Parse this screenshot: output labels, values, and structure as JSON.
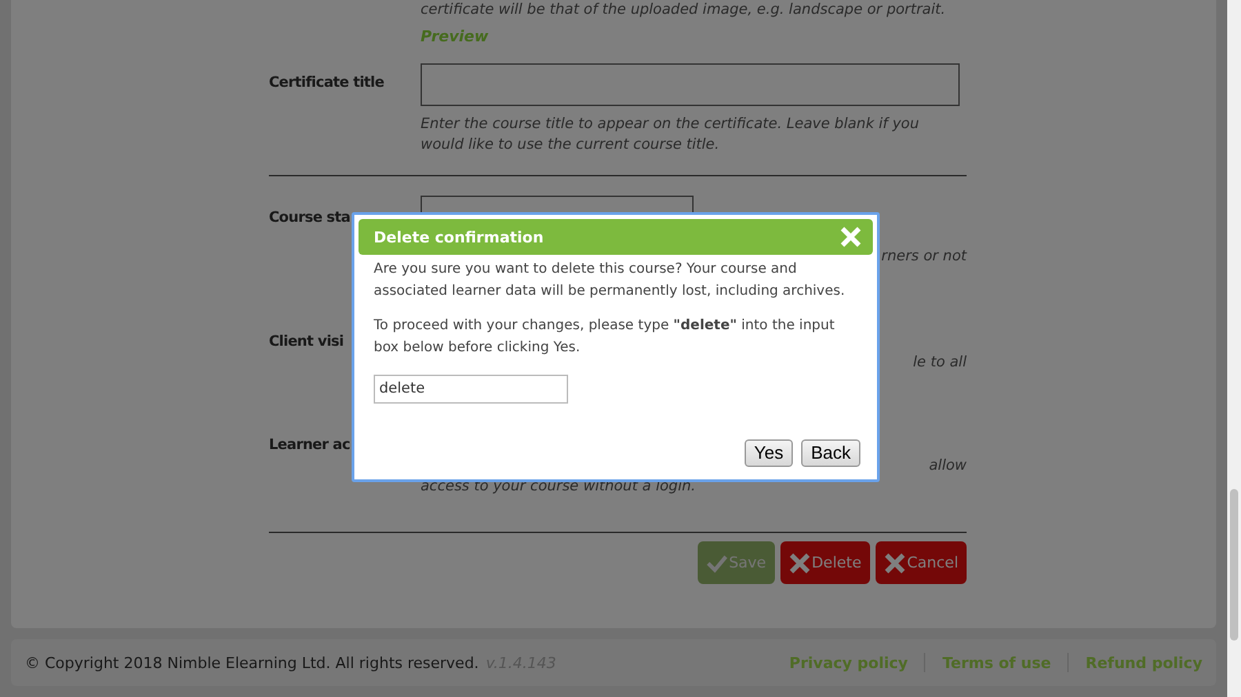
{
  "form": {
    "intro": {
      "text": "certificate will be that of the uploaded image, e.g. landscape or portrait.",
      "link": "Preview"
    },
    "rows": [
      {
        "label": "Certificate title",
        "kind": "input",
        "help": [
          {
            "kind": "full",
            "text": "Enter the course title to appear on the certificate. Leave blank if you would like to use the current course title."
          }
        ]
      },
      {
        "label": "Course sta",
        "kind": "input",
        "help": [
          {
            "kind": "cut",
            "text": "rners or not"
          }
        ]
      },
      {
        "label": "Client visi",
        "kind": "text",
        "help": [
          {
            "kind": "cut",
            "text": "le to all"
          }
        ]
      },
      {
        "label": "Learner ac",
        "kind": "text",
        "help": [
          {
            "kind": "cut",
            "text": "allow"
          },
          {
            "kind": "full",
            "text": "access to your course without a login."
          }
        ]
      }
    ],
    "buttons": [
      {
        "label": "Save",
        "kind": "save",
        "disabled": true
      },
      {
        "label": "Delete",
        "kind": "delete",
        "disabled": false
      },
      {
        "label": "Cancel",
        "kind": "cancel",
        "disabled": false
      }
    ]
  },
  "dialog": {
    "title": "Delete confirmation",
    "paragraphs": [
      "Are you sure you want to delete this course? Your course and associated learner data will be permanently lost, including archives.",
      "To proceed with your changes, please type **\"delete\"** into the input box below before clicking Yes."
    ],
    "input_value": "delete",
    "buttons": [
      "Yes",
      "Back"
    ]
  },
  "footer": {
    "copyright": "© Copyright 2018 Nimble Elearning Ltd. All rights reserved.",
    "version": "v.1.4.143",
    "links": [
      "Privacy policy",
      "Terms of use",
      "Refund policy"
    ]
  }
}
